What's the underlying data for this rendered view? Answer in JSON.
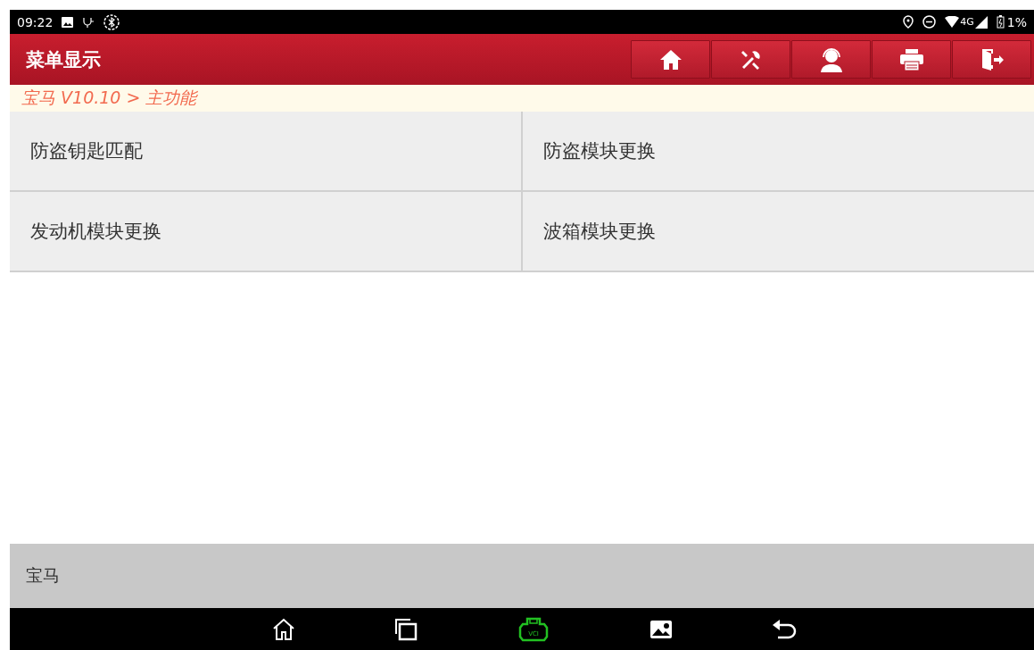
{
  "status_bar": {
    "time": "09:22",
    "network": "4G",
    "battery": "1%"
  },
  "header": {
    "title": "菜单显示",
    "buttons": [
      {
        "kind": "home"
      },
      {
        "kind": "tools"
      },
      {
        "kind": "support"
      },
      {
        "kind": "print"
      },
      {
        "kind": "exit"
      }
    ]
  },
  "breadcrumb": "宝马 V10.10 > 主功能",
  "menu_items": [
    {
      "label": "防盗钥匙匹配"
    },
    {
      "label": "防盗模块更换"
    },
    {
      "label": "发动机模块更换"
    },
    {
      "label": "波箱模块更换"
    }
  ],
  "footer": {
    "label": "宝马"
  },
  "nav_bar": {
    "buttons": [
      {
        "kind": "home"
      },
      {
        "kind": "recents"
      },
      {
        "kind": "vci",
        "label": "VCI"
      },
      {
        "kind": "gallery"
      },
      {
        "kind": "back"
      }
    ]
  }
}
